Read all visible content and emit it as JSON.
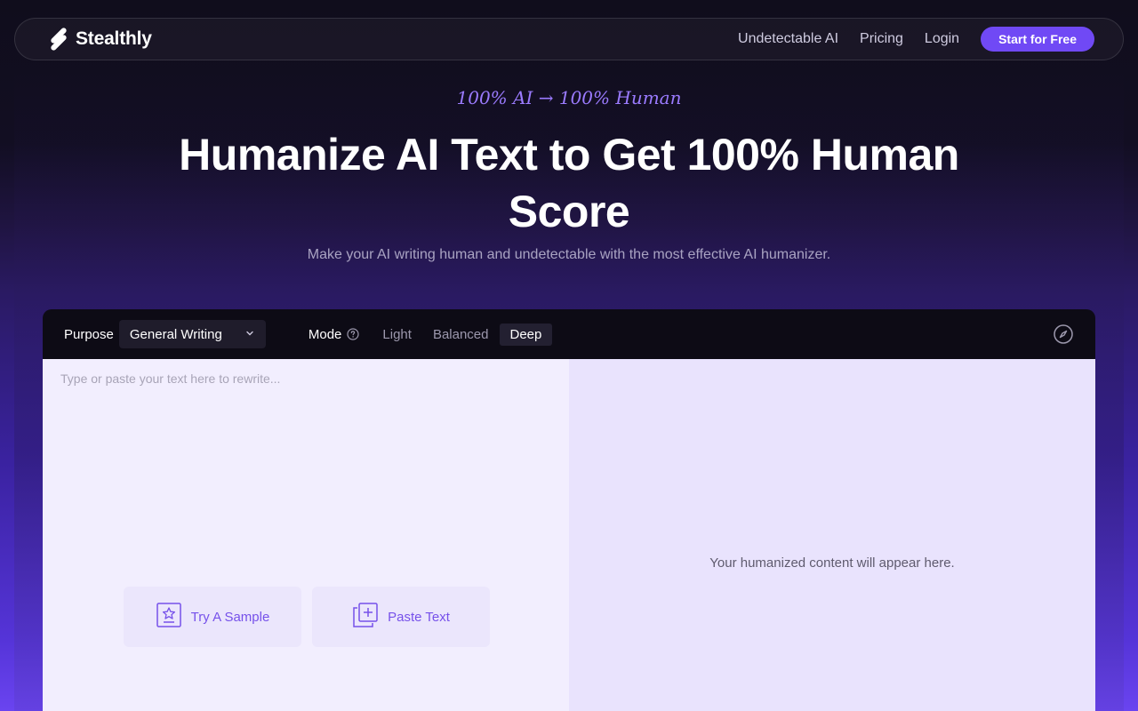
{
  "nav": {
    "brand": "Stealthly",
    "links": [
      "Undetectable AI",
      "Pricing",
      "Login"
    ],
    "cta": "Start for Free"
  },
  "hero": {
    "tagline": "100% AI → 100% Human",
    "title": "Humanize AI Text to Get 100% Human Score",
    "subtitle": "Make your AI writing human and undetectable with the most effective AI humanizer."
  },
  "toolbar": {
    "purpose_label": "Purpose",
    "purpose_value": "General Writing",
    "mode_label": "Mode",
    "modes": [
      "Light",
      "Balanced",
      "Deep"
    ],
    "active_mode": "Deep"
  },
  "editor": {
    "input_placeholder": "Type or paste your text here to rewrite...",
    "sample_button": "Try A Sample",
    "paste_button": "Paste Text",
    "output_placeholder": "Your humanized content will appear here."
  },
  "colors": {
    "accent": "#7049f5",
    "accent_text": "#7651ea",
    "tagline": "#9b7bff"
  },
  "icons": [
    "logo-icon",
    "chevron-down-icon",
    "help-circle-icon",
    "compass-icon",
    "star-card-icon",
    "copy-plus-icon"
  ]
}
